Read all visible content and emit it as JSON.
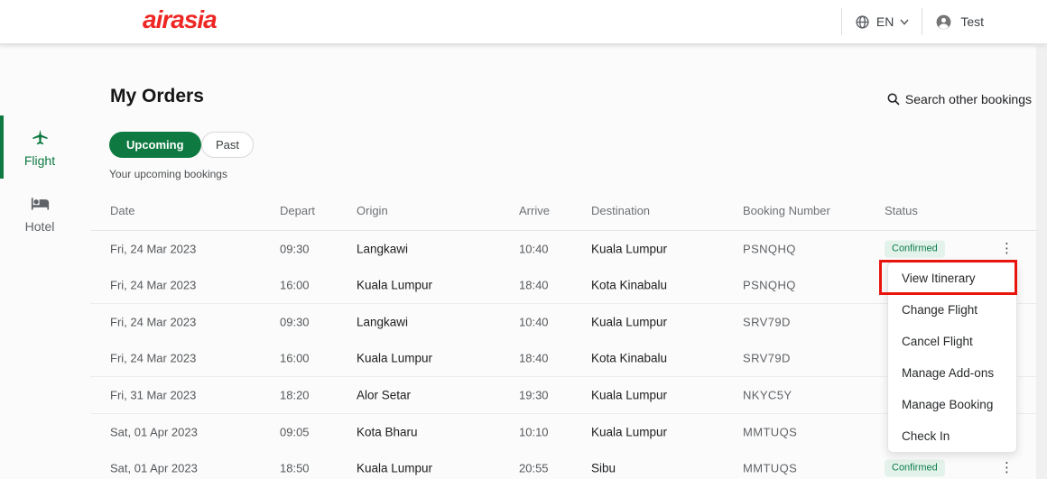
{
  "header": {
    "logo_text": "airasia",
    "language_label": "EN",
    "user_name": "Test"
  },
  "sidebar": {
    "items": [
      {
        "label": "Flight",
        "icon": "plane-icon",
        "active": true
      },
      {
        "label": "Hotel",
        "icon": "bed-icon",
        "active": false
      }
    ]
  },
  "page": {
    "title": "My Orders",
    "search_link": "Search other bookings",
    "tabs": [
      {
        "label": "Upcoming",
        "selected": true
      },
      {
        "label": "Past",
        "selected": false
      }
    ],
    "subtitle": "Your upcoming bookings"
  },
  "table": {
    "columns": [
      "Date",
      "Depart",
      "Origin",
      "Arrive",
      "Destination",
      "Booking Number",
      "Status"
    ],
    "rows": [
      {
        "date": "Fri, 24 Mar 2023",
        "depart": "09:30",
        "origin": "Langkawi",
        "arrive": "10:40",
        "destination": "Kuala Lumpur",
        "booking": "PSNQHQ",
        "status": "Confirmed",
        "status_visible": true,
        "group_end": false
      },
      {
        "date": "Fri, 24 Mar 2023",
        "depart": "16:00",
        "origin": "Kuala Lumpur",
        "arrive": "18:40",
        "destination": "Kota Kinabalu",
        "booking": "PSNQHQ",
        "status": "",
        "status_visible": false,
        "group_end": true
      },
      {
        "date": "Fri, 24 Mar 2023",
        "depart": "09:30",
        "origin": "Langkawi",
        "arrive": "10:40",
        "destination": "Kuala Lumpur",
        "booking": "SRV79D",
        "status": "",
        "status_visible": false,
        "group_end": false
      },
      {
        "date": "Fri, 24 Mar 2023",
        "depart": "16:00",
        "origin": "Kuala Lumpur",
        "arrive": "18:40",
        "destination": "Kota Kinabalu",
        "booking": "SRV79D",
        "status": "",
        "status_visible": false,
        "group_end": true
      },
      {
        "date": "Fri, 31 Mar 2023",
        "depart": "18:20",
        "origin": "Alor Setar",
        "arrive": "19:30",
        "destination": "Kuala Lumpur",
        "booking": "NKYC5Y",
        "status": "",
        "status_visible": false,
        "group_end": true
      },
      {
        "date": "Sat, 01 Apr 2023",
        "depart": "09:05",
        "origin": "Kota Bharu",
        "arrive": "10:10",
        "destination": "Kuala Lumpur",
        "booking": "MMTUQS",
        "status": "",
        "status_visible": false,
        "group_end": false
      },
      {
        "date": "Sat, 01 Apr 2023",
        "depart": "18:50",
        "origin": "Kuala Lumpur",
        "arrive": "20:55",
        "destination": "Sibu",
        "booking": "MMTUQS",
        "status": "Confirmed",
        "status_visible": true,
        "group_end": false
      }
    ]
  },
  "context_menu": {
    "items": [
      "View Itinerary",
      "Change Flight",
      "Cancel Flight",
      "Manage Add-ons",
      "Manage Booking",
      "Check In"
    ],
    "highlighted_item": "View Itinerary"
  },
  "colors": {
    "brand_red": "#ee2624",
    "brand_green": "#0e7a41",
    "badge_bg": "#e3f2ea",
    "badge_text": "#0f7d4e",
    "highlight_red": "#e8150d"
  }
}
